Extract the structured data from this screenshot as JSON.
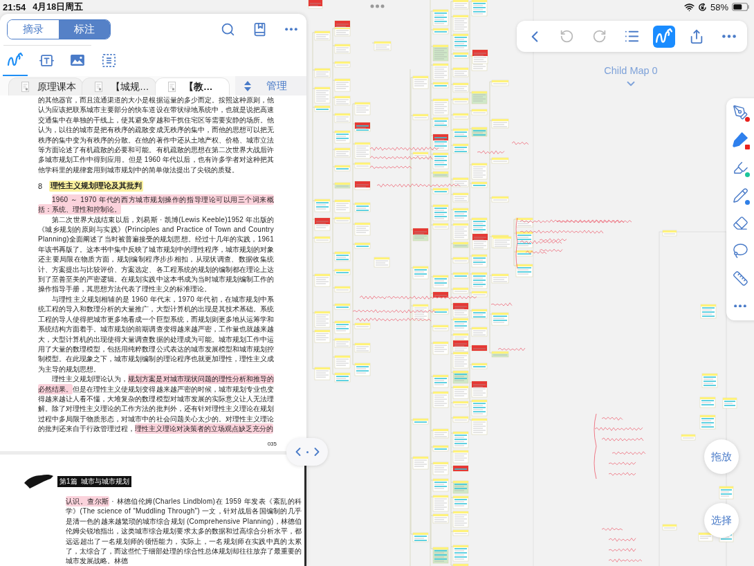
{
  "status_bar": {
    "time": "21:54",
    "date": "4月18日周五",
    "battery": "58%"
  },
  "reader": {
    "mode_tabs": [
      {
        "label": "摘录",
        "selected": false
      },
      {
        "label": "标注",
        "selected": true
      }
    ],
    "tools": [
      {
        "kind": "pen",
        "selected": true
      },
      {
        "kind": "text",
        "selected": false
      },
      {
        "kind": "image",
        "selected": false
      },
      {
        "kind": "select",
        "selected": false
      }
    ],
    "documents": [
      {
        "title": "原理课本",
        "selected": false
      },
      {
        "title": "【城规…",
        "selected": false
      },
      {
        "title": "【教…",
        "selected": true
      }
    ],
    "manage_button": "管理",
    "pages": [
      {
        "blocks": [
          {
            "kind": "paragraph",
            "indent": false,
            "segments": [
              {
                "text": "的其他器官，而且流通渠道的大小是根据运量的多少而定。按照这种原则，他认为应该把联系城市主要部分的快车道设在带状绿地系统中，也就是说把高速交通集中在单独的干线上，使其避免穿越和干扰住宅区等需要安静的场所。他认为，以往的城市是把有秩序的疏散变成无秩序的集中，而他的思想可以把无秩序的集中变为有秩序的分散。在他的著作中还从土地产权、价格、城市立法等方面论述了有机疏散的必要和可能。有机疏散的思想在第二次世界大战后许多城市规划工作中得到应用。但是 1960 年代以后，也有许多学者对这种把其他学科里的规律套用到城市规划中的简单做法提出了尖锐的质疑。"
              }
            ]
          },
          {
            "kind": "heading",
            "number": "8",
            "text": "理性主义规划理论及其批判",
            "color": "#fcf2a0"
          },
          {
            "kind": "paragraph",
            "indent": true,
            "segments": [
              {
                "text": "1960 ～ 1970 年代的西方城市规划操作的指导理论可以用三个词来概括：系统、理性和控制论。",
                "color": "#fbd3dc"
              }
            ]
          },
          {
            "kind": "paragraph",
            "indent": true,
            "segments": [
              {
                "text": "第二次世界大战结束以后，刘易斯 · 凯博(Lewis Keeble)1952 年出版的《城乡规划的原则与实践》(Principles and Practice of Town and Country Planning)全面阐述了当时被普遍接受的规划思想。经过十几年的实践，1961 年该书再版了。这本书中集中反映了城市规划中的理性程序，城市规划的对象还主要局限在物质方面，规划编制程序步步相扣，从现状调查、数据收集统计、方案提出与比较评价、方案选定、各工程系统的规划的编制都在理论上达到了至善至美的严密逻辑。在规划实践中这本书成为当时城市规划编制工作的操作指导手册，其思想方法代表了理性主义的标准理论。"
              }
            ]
          },
          {
            "kind": "paragraph",
            "indent": true,
            "segments": [
              {
                "text": "与理性主义规划相辅的是 1960 年代末，1970 年代初，在城市规划中系统工程的导入和数理分析的大量推广，大型计算机的出现是其技术基础。系统工程的导人使得把城市更多地看成一个巨型系统，而规划则更多地从运筹学和系统结构方面着手。城市规划的前期调查变得越来越严密，工作量也就越来越大，大型计算机的出现使得大量调查数据的处理成为可能。城市规划工作中运用了大量的数理模型，包括用纯粹数理公式表达的城市发展模型和城市规划控制模型。在此现象之下，城市规划编制的理论程序也就更加理性，理性主义成为主导的规划思想。"
              }
            ]
          },
          {
            "kind": "paragraph",
            "indent": true,
            "segments": [
              {
                "text": "理性主义规划理论认为，"
              },
              {
                "text": "规划方案是对城市现状问题的理性分析和推导的必然结果。",
                "color": "#fbd3dc"
              },
              {
                "text": "但是在理性主义使规划变得越来越严密的时候，城市规划专业也变得越来越让人看不懂，大堆复杂的数理模型对城市发展的实际意义让人无法理解。除了对理性主义理论的工作方法的批判外，还有针对理性主义理论在规划过程中多局限于物质形态，对城市中的社会问题关心太少的。对理性主义理论的批判还来自于行政管理过程，"
              },
              {
                "text": "理性主义理论对决策者的立场观点缺乏充分的",
                "color": "#fbd3dc"
              }
            ]
          }
        ],
        "page_number": "035"
      },
      {
        "header": "第1篇  城市与城市规划",
        "blocks": [
          {
            "kind": "paragraph",
            "indent": false,
            "segments": [
              {
                "text": "认识。查尔斯",
                "color": "#fbd3dc"
              },
              {
                "text": " · 林德伯伦姆(Charles Lindblom)在 1959 年发表《紊乱的科学》(The science of “Muddling Through”) 一文，针对战后各国编制的几乎是清一色的越来越繁琐的城市综合规划 (Comprehensive Planning)，林德伯伦姆尖锐地指出，这类城市综合规划要求太多的数据和过高综合分析水平，都远远超出了一名规划师的领悟能力，实际上，一名规划师在实践中真的太累了，太综合了，而这些忙于细部处理的综合性总体规划却往往放弃了最重要的城市发展战略。林德"
              }
            ]
          }
        ]
      }
    ]
  },
  "mind_map": {
    "title": "Child Map 0",
    "toolbar": [
      {
        "kind": "back",
        "selected": false,
        "disabled": false
      },
      {
        "kind": "undo",
        "selected": false,
        "disabled": true
      },
      {
        "kind": "redo",
        "selected": false,
        "disabled": true
      },
      {
        "kind": "outline",
        "selected": false,
        "disabled": false
      },
      {
        "kind": "draw",
        "selected": true,
        "disabled": false
      },
      {
        "kind": "share",
        "selected": false,
        "disabled": false
      },
      {
        "kind": "more",
        "selected": false,
        "disabled": false
      }
    ],
    "palette": [
      {
        "kind": "fountain-pen",
        "selected": false,
        "color": "#e8221e"
      },
      {
        "kind": "marker",
        "selected": true,
        "color": "#e8221e"
      },
      {
        "kind": "highlighter",
        "selected": false,
        "color": "#1cc59a"
      },
      {
        "kind": "pencil",
        "selected": false,
        "color": "#2f7fe6"
      },
      {
        "kind": "eraser",
        "selected": false
      },
      {
        "kind": "lasso",
        "selected": false
      },
      {
        "kind": "ruler",
        "selected": false
      },
      {
        "kind": "more",
        "selected": false
      }
    ],
    "buttons": [
      {
        "label": "拖放"
      },
      {
        "label": "选择"
      }
    ]
  }
}
